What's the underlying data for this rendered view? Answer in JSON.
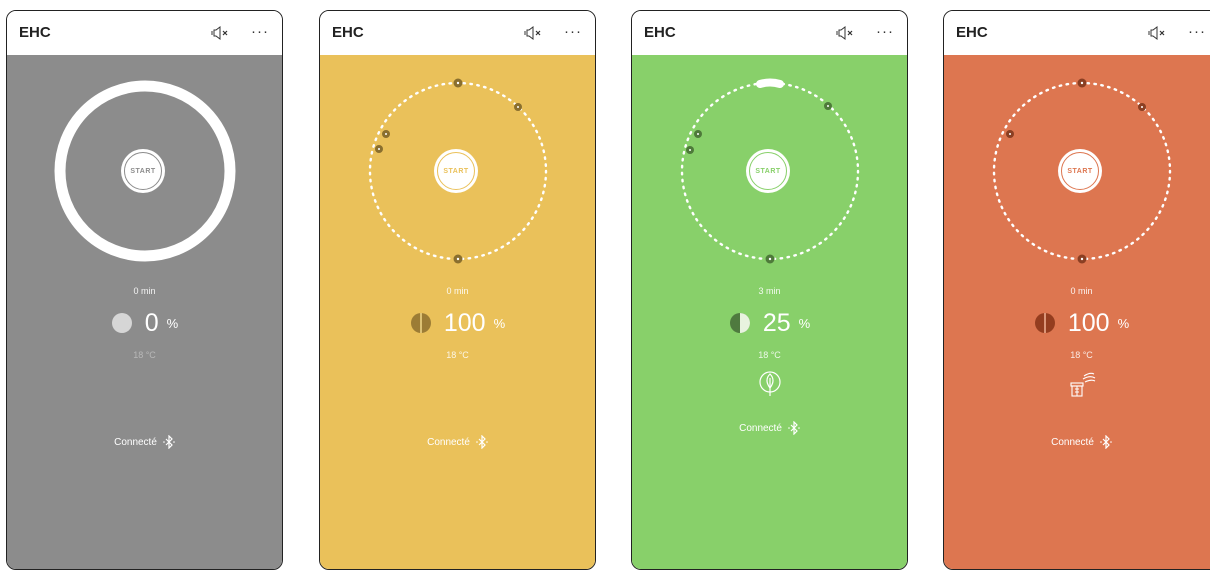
{
  "phones": [
    {
      "title": "EHC",
      "bg": "#8c8c8c",
      "start_label": "START",
      "start_color": "#8c8c8c",
      "time": "0 min",
      "level_value": "0",
      "level_unit": "%",
      "temperature": "18 °C",
      "status": "Connecté",
      "mode_icon": "none",
      "dial_style": "solid-ring"
    },
    {
      "title": "EHC",
      "bg": "#eac15a",
      "start_label": "START",
      "start_color": "#eac15a",
      "time": "0 min",
      "level_value": "100",
      "level_unit": "%",
      "temperature": "18 °C",
      "status": "Connecté",
      "mode_icon": "none",
      "dial_style": "dotted-ring"
    },
    {
      "title": "EHC",
      "bg": "#88d06a",
      "start_label": "START",
      "start_color": "#88d06a",
      "time": "3 min",
      "level_value": "25",
      "level_unit": "%",
      "temperature": "18 °C",
      "status": "Connecté",
      "mode_icon": "leaf-icon",
      "dial_style": "dotted-ring"
    },
    {
      "title": "EHC",
      "bg": "#dd7650",
      "start_label": "START",
      "start_color": "#dd7650",
      "time": "0 min",
      "level_value": "100",
      "level_unit": "%",
      "temperature": "18 °C",
      "status": "Connecté",
      "mode_icon": "fireplace-icon",
      "dial_style": "dotted-ring"
    }
  ]
}
